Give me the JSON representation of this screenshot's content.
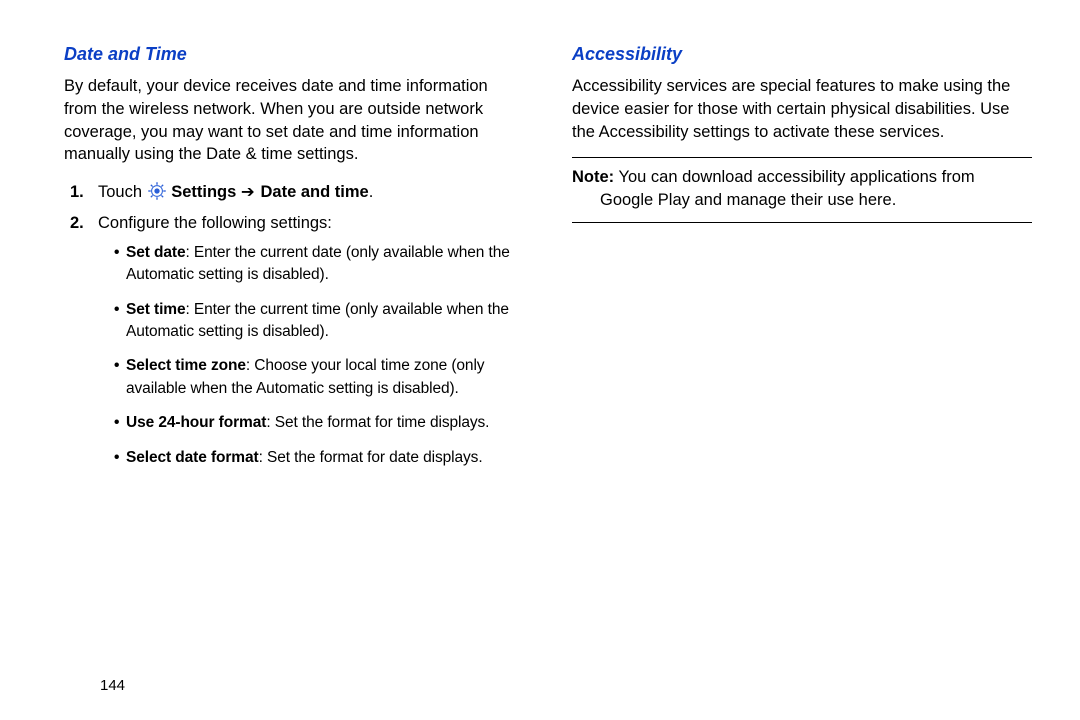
{
  "left": {
    "heading": "Date and Time",
    "intro": "By default, your device receives date and time information from the wireless network. When you are outside network coverage, you may want to set date and time information manually using the Date & time settings.",
    "step1_num": "1.",
    "step1_touch": "Touch ",
    "step1_settings": "Settings",
    "step1_arrow": " ➔ ",
    "step1_target": "Date and time",
    "step1_period": ".",
    "step2_num": "2.",
    "step2_text": "Configure the following settings:",
    "bullets": [
      {
        "label": "Set date",
        "rest": ": Enter the current date (only available when the Automatic setting is disabled)."
      },
      {
        "label": "Set time",
        "rest": ": Enter the current time (only available when the Automatic setting is disabled)."
      },
      {
        "label": "Select time zone",
        "rest": ": Choose your local time zone (only available when the Automatic setting is disabled)."
      },
      {
        "label": "Use 24-hour format",
        "rest": ": Set the format for time displays."
      },
      {
        "label": "Select date format",
        "rest": ": Set the format for date displays."
      }
    ]
  },
  "right": {
    "heading": "Accessibility",
    "intro": "Accessibility services are special features to make using the device easier for those with certain physical disabilities. Use the Accessibility settings to activate these services.",
    "note_label": "Note:",
    "note_line1": " You can download accessibility applications from",
    "note_line2": "Google Play and manage their use here."
  },
  "page_number": "144"
}
